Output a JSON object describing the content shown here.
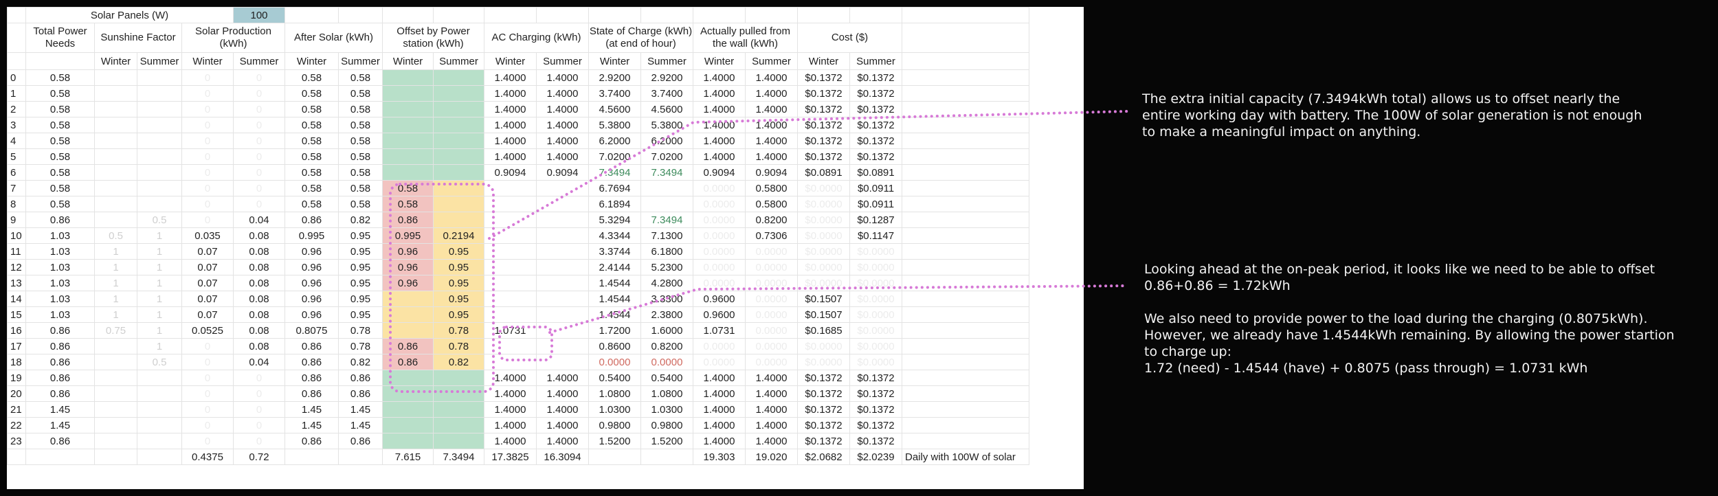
{
  "sheet": {
    "top_label": "Solar Panels (W)",
    "panel_watts": "100",
    "groups": [
      "Total Power Needs",
      "Sunshine Factor",
      "Solar Production (kWh)",
      "After Solar (kWh)",
      "Offset by Power station (kWh)",
      "AC Charging (kWh)",
      "State of Charge (kWh) (at end of hour)",
      "Actually pulled from the wall (kWh)",
      "Cost ($)"
    ],
    "season_winter": "Winter",
    "season_summer": "Summer",
    "rows": [
      [
        "0",
        "0.58",
        "",
        "",
        "0",
        "0",
        "0.58",
        "0.58",
        "",
        "",
        "1.4000",
        "1.4000",
        "2.9200",
        "2.9200",
        "1.4000",
        "1.4000",
        "$0.1372",
        "$0.1372"
      ],
      [
        "1",
        "0.58",
        "",
        "",
        "0",
        "0",
        "0.58",
        "0.58",
        "",
        "",
        "1.4000",
        "1.4000",
        "3.7400",
        "3.7400",
        "1.4000",
        "1.4000",
        "$0.1372",
        "$0.1372"
      ],
      [
        "2",
        "0.58",
        "",
        "",
        "0",
        "0",
        "0.58",
        "0.58",
        "",
        "",
        "1.4000",
        "1.4000",
        "4.5600",
        "4.5600",
        "1.4000",
        "1.4000",
        "$0.1372",
        "$0.1372"
      ],
      [
        "3",
        "0.58",
        "",
        "",
        "0",
        "0",
        "0.58",
        "0.58",
        "",
        "",
        "1.4000",
        "1.4000",
        "5.3800",
        "5.3800",
        "1.4000",
        "1.4000",
        "$0.1372",
        "$0.1372"
      ],
      [
        "4",
        "0.58",
        "",
        "",
        "0",
        "0",
        "0.58",
        "0.58",
        "",
        "",
        "1.4000",
        "1.4000",
        "6.2000",
        "6.2000",
        "1.4000",
        "1.4000",
        "$0.1372",
        "$0.1372"
      ],
      [
        "5",
        "0.58",
        "",
        "",
        "0",
        "0",
        "0.58",
        "0.58",
        "",
        "",
        "1.4000",
        "1.4000",
        "7.0200",
        "7.0200",
        "1.4000",
        "1.4000",
        "$0.1372",
        "$0.1372"
      ],
      [
        "6",
        "0.58",
        "",
        "",
        "0",
        "0",
        "0.58",
        "0.58",
        "",
        "",
        "0.9094",
        "0.9094",
        "7.3494",
        "7.3494",
        "0.9094",
        "0.9094",
        "$0.0891",
        "$0.0891"
      ],
      [
        "7",
        "0.58",
        "",
        "",
        "0",
        "0",
        "0.58",
        "0.58",
        "0.58",
        "",
        "",
        "",
        "6.7694",
        "",
        "0.0000",
        "0.5800",
        "$0.0000",
        "$0.0911"
      ],
      [
        "8",
        "0.58",
        "",
        "",
        "0",
        "0",
        "0.58",
        "0.58",
        "0.58",
        "",
        "",
        "",
        "6.1894",
        "",
        "0.0000",
        "0.5800",
        "$0.0000",
        "$0.0911"
      ],
      [
        "9",
        "0.86",
        "",
        "0.5",
        "0",
        "0.04",
        "0.86",
        "0.82",
        "0.86",
        "",
        "",
        "",
        "5.3294",
        "7.3494",
        "0.0000",
        "0.8200",
        "$0.0000",
        "$0.1287"
      ],
      [
        "10",
        "1.03",
        "0.5",
        "1",
        "0.035",
        "0.08",
        "0.995",
        "0.95",
        "0.995",
        "0.2194",
        "",
        "",
        "4.3344",
        "7.1300",
        "0.0000",
        "0.7306",
        "$0.0000",
        "$0.1147"
      ],
      [
        "11",
        "1.03",
        "1",
        "1",
        "0.07",
        "0.08",
        "0.96",
        "0.95",
        "0.96",
        "0.95",
        "",
        "",
        "3.3744",
        "6.1800",
        "0.0000",
        "0.0000",
        "$0.0000",
        "$0.0000"
      ],
      [
        "12",
        "1.03",
        "1",
        "1",
        "0.07",
        "0.08",
        "0.96",
        "0.95",
        "0.96",
        "0.95",
        "",
        "",
        "2.4144",
        "5.2300",
        "0.0000",
        "0.0000",
        "$0.0000",
        "$0.0000"
      ],
      [
        "13",
        "1.03",
        "1",
        "1",
        "0.07",
        "0.08",
        "0.96",
        "0.95",
        "0.96",
        "0.95",
        "",
        "",
        "1.4544",
        "4.2800",
        "0.0000",
        "0.0000",
        "$0.0000",
        "$0.0000"
      ],
      [
        "14",
        "1.03",
        "1",
        "1",
        "0.07",
        "0.08",
        "0.96",
        "0.95",
        "",
        "0.95",
        "",
        "",
        "1.4544",
        "3.3300",
        "0.9600",
        "0.0000",
        "$0.1507",
        "$0.0000"
      ],
      [
        "15",
        "1.03",
        "1",
        "1",
        "0.07",
        "0.08",
        "0.96",
        "0.95",
        "",
        "0.95",
        "",
        "",
        "1.4544",
        "2.3800",
        "0.9600",
        "0.0000",
        "$0.1507",
        "$0.0000"
      ],
      [
        "16",
        "0.86",
        "0.75",
        "1",
        "0.0525",
        "0.08",
        "0.8075",
        "0.78",
        "",
        "0.78",
        "1.0731",
        "",
        "1.7200",
        "1.6000",
        "1.0731",
        "0.0000",
        "$0.1685",
        "$0.0000"
      ],
      [
        "17",
        "0.86",
        "",
        "1",
        "0",
        "0.08",
        "0.86",
        "0.78",
        "0.86",
        "0.78",
        "",
        "",
        "0.8600",
        "0.8200",
        "0.0000",
        "0.0000",
        "$0.0000",
        "$0.0000"
      ],
      [
        "18",
        "0.86",
        "",
        "0.5",
        "0",
        "0.04",
        "0.86",
        "0.82",
        "0.86",
        "0.82",
        "",
        "",
        "0.0000",
        "0.0000",
        "0.0000",
        "0.0000",
        "$0.0000",
        "$0.0000"
      ],
      [
        "19",
        "0.86",
        "",
        "",
        "0",
        "0",
        "0.86",
        "0.86",
        "",
        "",
        "1.4000",
        "1.4000",
        "0.5400",
        "0.5400",
        "1.4000",
        "1.4000",
        "$0.1372",
        "$0.1372"
      ],
      [
        "20",
        "0.86",
        "",
        "",
        "0",
        "0",
        "0.86",
        "0.86",
        "",
        "",
        "1.4000",
        "1.4000",
        "1.0800",
        "1.0800",
        "1.4000",
        "1.4000",
        "$0.1372",
        "$0.1372"
      ],
      [
        "21",
        "1.45",
        "",
        "",
        "0",
        "0",
        "1.45",
        "1.45",
        "",
        "",
        "1.4000",
        "1.4000",
        "1.0300",
        "1.0300",
        "1.4000",
        "1.4000",
        "$0.1372",
        "$0.1372"
      ],
      [
        "22",
        "1.45",
        "",
        "",
        "0",
        "0",
        "1.45",
        "1.45",
        "",
        "",
        "1.4000",
        "1.4000",
        "0.9800",
        "0.9800",
        "1.4000",
        "1.4000",
        "$0.1372",
        "$0.1372"
      ],
      [
        "23",
        "0.86",
        "",
        "",
        "0",
        "0",
        "0.86",
        "0.86",
        "",
        "",
        "1.4000",
        "1.4000",
        "1.5200",
        "1.5200",
        "1.4000",
        "1.4000",
        "$0.1372",
        "$0.1372"
      ]
    ],
    "totals": [
      "",
      "",
      "",
      "",
      "0.4375",
      "0.72",
      "",
      "",
      "7.615",
      "7.3494",
      "17.3825",
      "16.3094",
      "",
      "",
      "19.303",
      "19.020",
      "$2.0682",
      "$2.0239"
    ],
    "totals_note": "Daily with 100W of solar"
  },
  "annotations": {
    "note1": [
      "The extra initial capacity (7.3494kWh total) allows us to offset nearly the",
      "entire working day with battery. The 100W of solar generation is not enough",
      "to make a meaningful impact on anything."
    ],
    "note2": [
      "Looking ahead at the on-peak period, it looks like we need to be able to offset",
      "0.86+0.86 = 1.72kWh",
      "",
      "We also need to provide power to the load during the charging (0.8075kWh).",
      "However, we already have 1.4544kWh remaining. By allowing the power startion",
      "to charge up:",
      "1.72 (need)  - 1.4544 (have) + 0.8075 (pass through) = 1.0731 kWh"
    ]
  },
  "colors": {
    "offset_green": "#b8e0c9",
    "offset_red": "#f2c3c0",
    "offset_yellow": "#fbe3a4",
    "highlight_text_green": "#3d8b5c",
    "highlight_text_red": "#d06a60",
    "panel_input_bg": "#a7cbd3",
    "annotation_dots": "#d77ad7"
  }
}
